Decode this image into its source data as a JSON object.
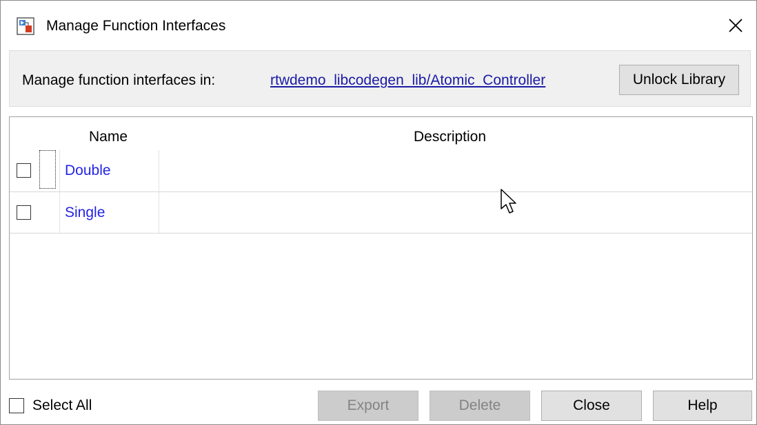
{
  "window": {
    "title": "Manage Function Interfaces",
    "app_icon": "simulink-app-icon",
    "close_icon": "close-icon"
  },
  "location": {
    "label": "Manage function interfaces in:",
    "link": "rtwdemo_libcodegen_lib/Atomic_Controller",
    "unlock_button": "Unlock Library"
  },
  "table": {
    "columns": [
      "Name",
      "Description"
    ],
    "rows": [
      {
        "checked": false,
        "name": "Double",
        "description": ""
      },
      {
        "checked": false,
        "name": "Single",
        "description": ""
      }
    ]
  },
  "footer": {
    "select_all_label": "Select All",
    "select_all_checked": false,
    "export_button": "Export",
    "export_enabled": false,
    "delete_button": "Delete",
    "delete_enabled": false,
    "close_button": "Close",
    "help_button": "Help"
  },
  "colors": {
    "link": "#1a1aa6",
    "row_name": "#2323e6",
    "band_bg": "#f0f0f0",
    "disabled_button_bg": "#cccccc"
  }
}
